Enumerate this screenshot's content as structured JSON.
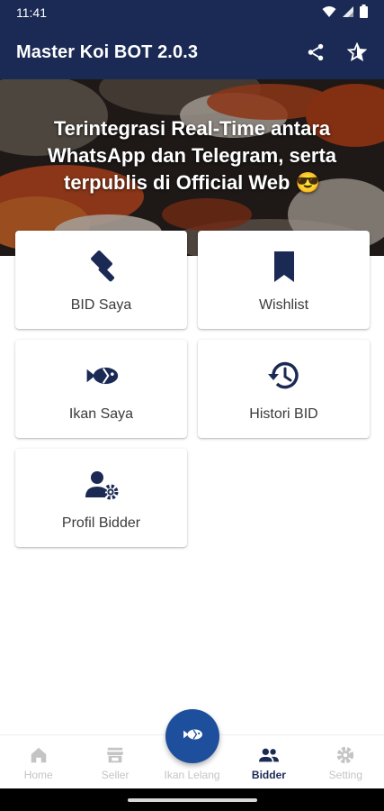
{
  "status_bar": {
    "time": "11:41",
    "icons": [
      "wifi-icon",
      "signal-icon",
      "battery-icon"
    ]
  },
  "app_bar": {
    "title": "Master Koi BOT 2.0.3",
    "actions": [
      {
        "name": "share",
        "icon": "share-icon"
      },
      {
        "name": "rate",
        "icon": "star-half-icon"
      }
    ],
    "background": "#1b2a55"
  },
  "hero": {
    "headline": "Terintegrasi Real-Time antara WhatsApp dan Telegram, serta terpublis di Official Web 😎"
  },
  "menu": [
    {
      "label": "BID Saya",
      "icon": "gavel-icon"
    },
    {
      "label": "Wishlist",
      "icon": "bookmark-icon"
    },
    {
      "label": "Ikan Saya",
      "icon": "fish-icon"
    },
    {
      "label": "Histori BID",
      "icon": "history-icon"
    },
    {
      "label": "Profil Bidder",
      "icon": "user-gear-icon"
    }
  ],
  "bottom_nav": {
    "items": [
      {
        "label": "Home",
        "icon": "home-icon",
        "active": false
      },
      {
        "label": "Seller",
        "icon": "store-icon",
        "active": false
      },
      {
        "label": "Ikan Lelang",
        "icon": "fish-icon",
        "active": false
      },
      {
        "label": "Bidder",
        "icon": "people-icon",
        "active": true
      },
      {
        "label": "Setting",
        "icon": "gear-icon",
        "active": false
      }
    ],
    "fab_icon": "fish-icon"
  },
  "colors": {
    "primary": "#1b2a55",
    "fab": "#1d4f9c",
    "icon": "#1b2a55",
    "inactive": "#c4c4c4"
  }
}
